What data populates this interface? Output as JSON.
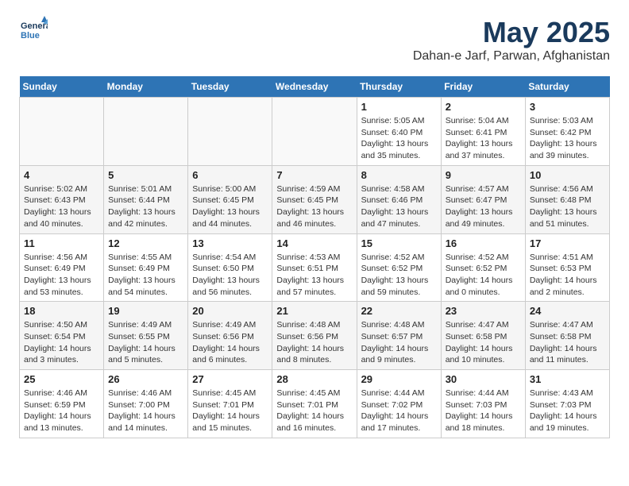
{
  "header": {
    "logo_line1": "General",
    "logo_line2": "Blue",
    "month_year": "May 2025",
    "location": "Dahan-e Jarf, Parwan, Afghanistan"
  },
  "days_of_week": [
    "Sunday",
    "Monday",
    "Tuesday",
    "Wednesday",
    "Thursday",
    "Friday",
    "Saturday"
  ],
  "weeks": [
    [
      {
        "day": "",
        "empty": true
      },
      {
        "day": "",
        "empty": true
      },
      {
        "day": "",
        "empty": true
      },
      {
        "day": "",
        "empty": true
      },
      {
        "day": "1",
        "sunrise": "5:05 AM",
        "sunset": "6:40 PM",
        "daylight": "13 hours and 35 minutes."
      },
      {
        "day": "2",
        "sunrise": "5:04 AM",
        "sunset": "6:41 PM",
        "daylight": "13 hours and 37 minutes."
      },
      {
        "day": "3",
        "sunrise": "5:03 AM",
        "sunset": "6:42 PM",
        "daylight": "13 hours and 39 minutes."
      }
    ],
    [
      {
        "day": "4",
        "sunrise": "5:02 AM",
        "sunset": "6:43 PM",
        "daylight": "13 hours and 40 minutes."
      },
      {
        "day": "5",
        "sunrise": "5:01 AM",
        "sunset": "6:44 PM",
        "daylight": "13 hours and 42 minutes."
      },
      {
        "day": "6",
        "sunrise": "5:00 AM",
        "sunset": "6:45 PM",
        "daylight": "13 hours and 44 minutes."
      },
      {
        "day": "7",
        "sunrise": "4:59 AM",
        "sunset": "6:45 PM",
        "daylight": "13 hours and 46 minutes."
      },
      {
        "day": "8",
        "sunrise": "4:58 AM",
        "sunset": "6:46 PM",
        "daylight": "13 hours and 47 minutes."
      },
      {
        "day": "9",
        "sunrise": "4:57 AM",
        "sunset": "6:47 PM",
        "daylight": "13 hours and 49 minutes."
      },
      {
        "day": "10",
        "sunrise": "4:56 AM",
        "sunset": "6:48 PM",
        "daylight": "13 hours and 51 minutes."
      }
    ],
    [
      {
        "day": "11",
        "sunrise": "4:56 AM",
        "sunset": "6:49 PM",
        "daylight": "13 hours and 53 minutes."
      },
      {
        "day": "12",
        "sunrise": "4:55 AM",
        "sunset": "6:49 PM",
        "daylight": "13 hours and 54 minutes."
      },
      {
        "day": "13",
        "sunrise": "4:54 AM",
        "sunset": "6:50 PM",
        "daylight": "13 hours and 56 minutes."
      },
      {
        "day": "14",
        "sunrise": "4:53 AM",
        "sunset": "6:51 PM",
        "daylight": "13 hours and 57 minutes."
      },
      {
        "day": "15",
        "sunrise": "4:52 AM",
        "sunset": "6:52 PM",
        "daylight": "13 hours and 59 minutes."
      },
      {
        "day": "16",
        "sunrise": "4:52 AM",
        "sunset": "6:52 PM",
        "daylight": "14 hours and 0 minutes."
      },
      {
        "day": "17",
        "sunrise": "4:51 AM",
        "sunset": "6:53 PM",
        "daylight": "14 hours and 2 minutes."
      }
    ],
    [
      {
        "day": "18",
        "sunrise": "4:50 AM",
        "sunset": "6:54 PM",
        "daylight": "14 hours and 3 minutes."
      },
      {
        "day": "19",
        "sunrise": "4:49 AM",
        "sunset": "6:55 PM",
        "daylight": "14 hours and 5 minutes."
      },
      {
        "day": "20",
        "sunrise": "4:49 AM",
        "sunset": "6:56 PM",
        "daylight": "14 hours and 6 minutes."
      },
      {
        "day": "21",
        "sunrise": "4:48 AM",
        "sunset": "6:56 PM",
        "daylight": "14 hours and 8 minutes."
      },
      {
        "day": "22",
        "sunrise": "4:48 AM",
        "sunset": "6:57 PM",
        "daylight": "14 hours and 9 minutes."
      },
      {
        "day": "23",
        "sunrise": "4:47 AM",
        "sunset": "6:58 PM",
        "daylight": "14 hours and 10 minutes."
      },
      {
        "day": "24",
        "sunrise": "4:47 AM",
        "sunset": "6:58 PM",
        "daylight": "14 hours and 11 minutes."
      }
    ],
    [
      {
        "day": "25",
        "sunrise": "4:46 AM",
        "sunset": "6:59 PM",
        "daylight": "14 hours and 13 minutes."
      },
      {
        "day": "26",
        "sunrise": "4:46 AM",
        "sunset": "7:00 PM",
        "daylight": "14 hours and 14 minutes."
      },
      {
        "day": "27",
        "sunrise": "4:45 AM",
        "sunset": "7:01 PM",
        "daylight": "14 hours and 15 minutes."
      },
      {
        "day": "28",
        "sunrise": "4:45 AM",
        "sunset": "7:01 PM",
        "daylight": "14 hours and 16 minutes."
      },
      {
        "day": "29",
        "sunrise": "4:44 AM",
        "sunset": "7:02 PM",
        "daylight": "14 hours and 17 minutes."
      },
      {
        "day": "30",
        "sunrise": "4:44 AM",
        "sunset": "7:03 PM",
        "daylight": "14 hours and 18 minutes."
      },
      {
        "day": "31",
        "sunrise": "4:43 AM",
        "sunset": "7:03 PM",
        "daylight": "14 hours and 19 minutes."
      }
    ]
  ]
}
